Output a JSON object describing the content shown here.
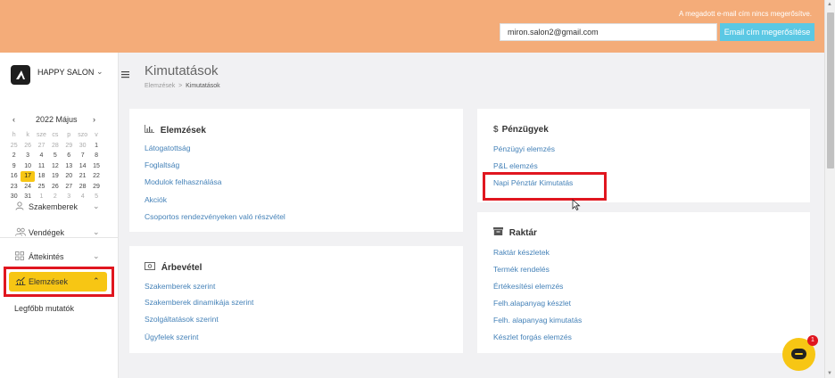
{
  "topbar": {
    "notice": "A megadott e-mail cím nincs megerősítve.",
    "email_value": "miron.salon2@gmail.com",
    "verify_label": "Email cím megerősítése"
  },
  "brand": {
    "name": "HAPPY SALON",
    "chevron": "⌄"
  },
  "calendar": {
    "prev": "‹",
    "month": "2022 Május",
    "next": "›",
    "dow": [
      "h",
      "k",
      "sze",
      "cs",
      "p",
      "szo",
      "v"
    ],
    "weeks": [
      [
        "25",
        "26",
        "27",
        "28",
        "29",
        "30",
        "1"
      ],
      [
        "2",
        "3",
        "4",
        "5",
        "6",
        "7",
        "8"
      ],
      [
        "9",
        "10",
        "11",
        "12",
        "13",
        "14",
        "15"
      ],
      [
        "16",
        "17",
        "18",
        "19",
        "20",
        "21",
        "22"
      ],
      [
        "23",
        "24",
        "25",
        "26",
        "27",
        "28",
        "29"
      ],
      [
        "30",
        "31",
        "1",
        "2",
        "3",
        "4",
        "5"
      ]
    ]
  },
  "nav": {
    "items": [
      {
        "label": "Szakemberek",
        "icon": "person-icon"
      },
      {
        "label": "Vendégek",
        "icon": "people-icon"
      },
      {
        "label": "Áttekintés",
        "icon": "grid-icon"
      },
      {
        "label": "Elemzések",
        "icon": "chart-icon"
      }
    ],
    "subitem": "Legfőbb mutatók"
  },
  "page": {
    "title": "Kimutatások",
    "breadcrumb_parent": "Elemzések",
    "breadcrumb_sep": ">",
    "breadcrumb_current": "Kimutatások"
  },
  "cards": {
    "elemzesek": {
      "title": "Elemzések",
      "links": [
        "Látogatottság",
        "Foglaltság",
        "Modulok felhasználása",
        "Akciók",
        "Csoportos rendezvényeken való részvétel"
      ]
    },
    "arbevetel": {
      "title": "Árbevétel",
      "links": [
        "Szakemberek szerint",
        "Szakemberek dinamikája szerint",
        "Szolgáltatások szerint",
        "Ügyfelek szerint"
      ]
    },
    "penzugyek": {
      "title": "Pénzügyek",
      "links": [
        "Pénzügyi elemzés",
        "P&L elemzés",
        "Napi Pénztár Kimutatás"
      ]
    },
    "raktar": {
      "title": "Raktár",
      "links": [
        "Raktár készletek",
        "Termék rendelés",
        "Értékesítési elemzés",
        "Felh.alapanyag készlet",
        "Felh. alapanyag kimutatás",
        "Készlet forgás elemzés"
      ]
    }
  },
  "chat": {
    "badge": "1"
  },
  "colors": {
    "topbar": "#f4ac79",
    "accent": "#f7c614",
    "link": "#4582b8",
    "highlight": "#e0161f",
    "verify": "#5bc8e4"
  }
}
